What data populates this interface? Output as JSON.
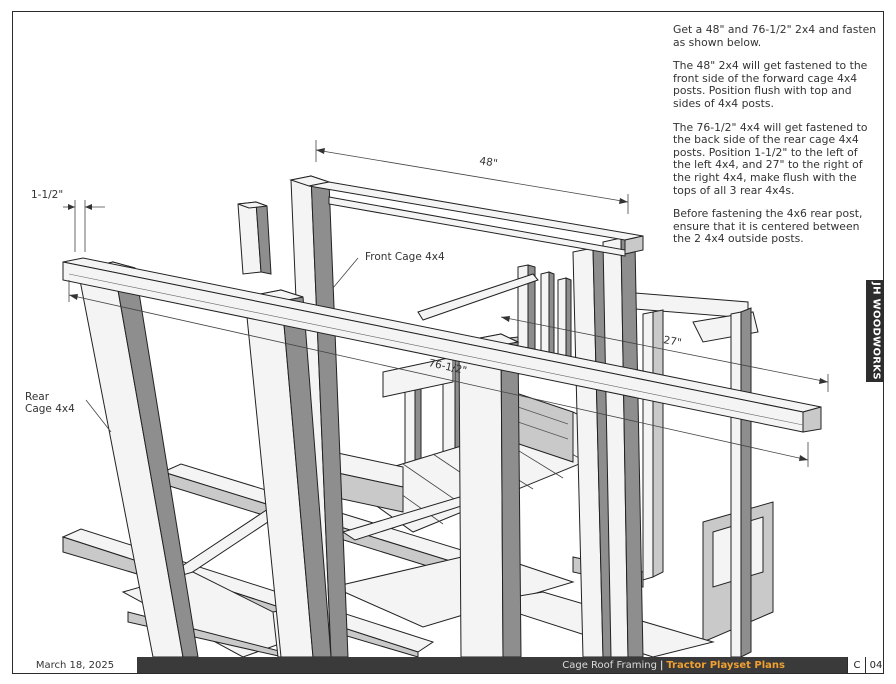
{
  "instructions": [
    "Get a 48\" and 76-1/2\" 2x4 and fasten as shown below.",
    "The 48\" 2x4 will get fastened to the front side of the forward cage 4x4 posts. Position flush with top and sides of 4x4 posts.",
    "The 76-1/2\" 4x4 will get fastened to the back side of the rear cage 4x4 posts. Position 1-1/2\" to the left of the left 4x4, and 27\" to the right of the right 4x4, make flush with the tops of all 3 rear 4x4s.",
    "Before fastening the 4x6 rear post, ensure that it is centered between the 2 4x4 outside posts."
  ],
  "callouts": {
    "offset": "1-1/2\"",
    "length_48": "48\"",
    "front_cage": "Front Cage 4x4",
    "length_76": "76-1/2\"",
    "length_27": "27\"",
    "rear_cage_line1": "Rear",
    "rear_cage_line2": "Cage 4x4"
  },
  "side_tab": "JH WOODWORKS",
  "footer": {
    "date": "March 18, 2025",
    "section_title": "Cage Roof Framing",
    "separator": "|",
    "project_title": "Tractor Playset Plans",
    "section_letter": "C",
    "page_number": "04"
  }
}
